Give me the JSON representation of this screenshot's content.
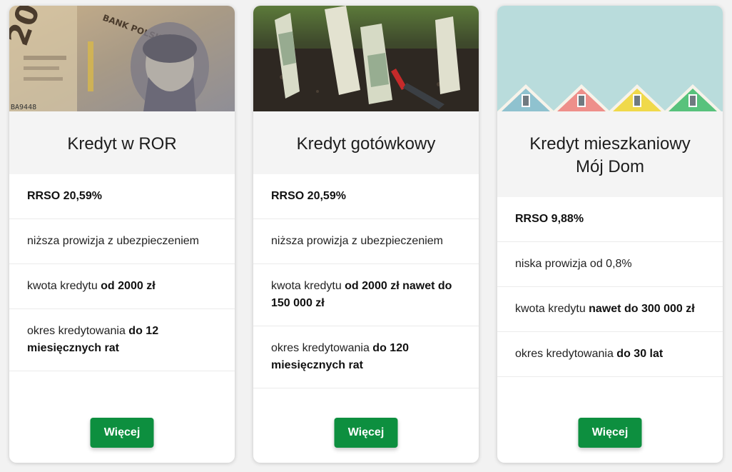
{
  "cards": [
    {
      "title": "Kredyt w ROR",
      "image": "polish-banknote-photo",
      "features": [
        {
          "bold_lead": "RRSO 20,59%"
        },
        {
          "text": "niższa prowizja z ubezpieczeniem"
        },
        {
          "text": "kwota kredytu ",
          "bold": "od 2000 zł"
        },
        {
          "text": "okres kredytowania ",
          "bold": "do 12 miesięcznych rat"
        }
      ],
      "button_label": "Więcej"
    },
    {
      "title": "Kredyt gotówkowy",
      "image": "dollar-bills-in-soil-photo",
      "features": [
        {
          "bold_lead": "RRSO 20,59%"
        },
        {
          "text": "niższa prowizja z ubezpieczeniem"
        },
        {
          "text": "kwota kredytu ",
          "bold": "od 2000 zł nawet do 150 000 zł"
        },
        {
          "text": "okres kredytowania ",
          "bold": "do 120 miesięcznych rat"
        }
      ],
      "button_label": "Więcej"
    },
    {
      "title_line1": "Kredyt mieszkaniowy",
      "title_line2": "Mój Dom",
      "image": "colorful-house-roofs-photo",
      "features": [
        {
          "bold_lead": "RRSO 9,88%"
        },
        {
          "text": "niska prowizja od 0,8%"
        },
        {
          "text": "kwota kredytu ",
          "bold": "nawet do 300 000 zł"
        },
        {
          "text": "okres kredytowania ",
          "bold": "do 30 lat"
        }
      ],
      "button_label": "Więcej"
    }
  ],
  "colors": {
    "button": "#0d8f3f",
    "title_band": "#f4f4f4",
    "page_background": "#f2f2f2"
  }
}
